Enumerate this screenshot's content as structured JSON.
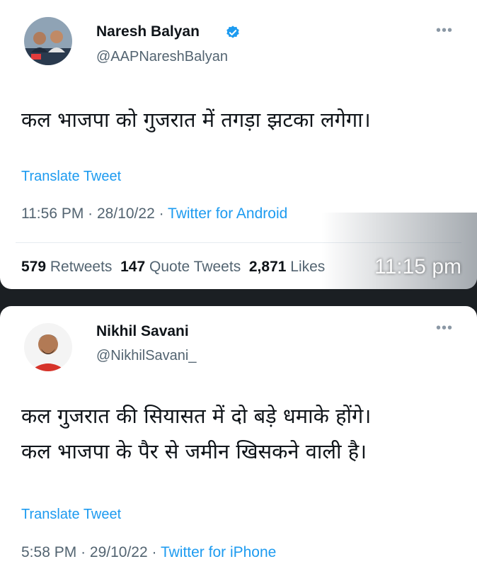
{
  "tweets": [
    {
      "name": "Naresh Balyan",
      "handle": "@AAPNareshBalyan",
      "verified": true,
      "text_lines": [
        "कल भाजपा को गुजरात में तगड़ा झटका लगेगा।"
      ],
      "translate": "Translate Tweet",
      "time": "11:56 PM",
      "date": "28/10/22",
      "source": "Twitter for Android",
      "stats": {
        "retweets": "579",
        "retweets_label": "Retweets",
        "quotes": "147",
        "quotes_label": "Quote Tweets",
        "likes": "2,871",
        "likes_label": "Likes"
      },
      "overlay_time": "11:15 pm",
      "more_icon": "more-icon"
    },
    {
      "name": "Nikhil Savani",
      "handle": "@NikhilSavani_",
      "verified": false,
      "text_lines": [
        "कल गुजरात की सियासत में दो बड़े धमाके होंगे।",
        "कल भाजपा के पैर से जमीन खिसकने वाली है।"
      ],
      "translate": "Translate Tweet",
      "time": "5:58 PM",
      "date": "29/10/22",
      "source": "Twitter for iPhone",
      "more_icon": "more-icon"
    }
  ],
  "colors": {
    "link": "#1d9bf0",
    "muted": "#536471",
    "text": "#0f1419",
    "background": "#1b1f23"
  }
}
